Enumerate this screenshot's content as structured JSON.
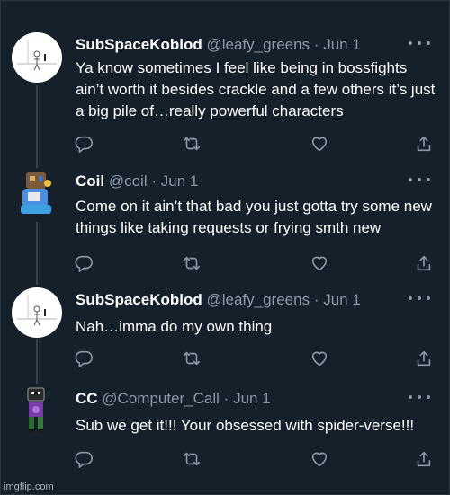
{
  "tweets": [
    {
      "name": "SubSpaceKoblod",
      "handle": "@leafy_greens",
      "separator": "·",
      "date": "Jun 1",
      "text": "Ya know sometimes I feel like being in bossfights ain’t worth it besides crackle and a few others it’s just a big pile of…really powerful characters",
      "avatar": "avatar-subspacekoblod"
    },
    {
      "name": "Coil",
      "handle": "@coil",
      "separator": "·",
      "date": "Jun 1",
      "text": "Come on it ain’t that bad you just gotta try some new things like taking requests or frying smth new",
      "avatar": "avatar-coil"
    },
    {
      "name": "SubSpaceKoblod",
      "handle": "@leafy_greens",
      "separator": "·",
      "date": "Jun 1",
      "text": "Nah…imma do my own thing",
      "avatar": "avatar-subspacekoblod"
    },
    {
      "name": "CC",
      "handle": "@Computer_Call",
      "separator": "·",
      "date": "Jun 1",
      "text": "Sub we get it!!! Your obsessed with spider-verse!!!",
      "avatar": "avatar-cc"
    }
  ],
  "icons": [
    "reply-icon",
    "retweet-icon",
    "like-icon",
    "share-icon",
    "more-icon"
  ],
  "colors": {
    "background": "#15202b",
    "secondary_text": "#8b98a5",
    "thread_line": "#38444d"
  },
  "watermark": "imgflip.com"
}
